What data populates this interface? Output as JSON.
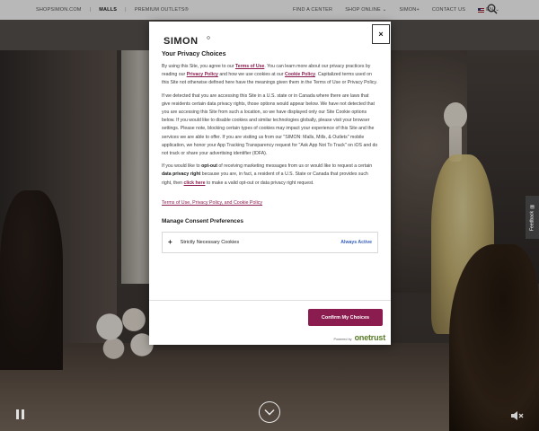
{
  "nav": {
    "left": [
      "SHOPSIMON.COM",
      "MALLS",
      "PREMIUM OUTLETS®"
    ],
    "right": [
      "FIND A CENTER",
      "SHOP ONLINE",
      "SIMON+",
      "CONTACT US"
    ],
    "language": "EN"
  },
  "feedback": {
    "label": "Feedback"
  },
  "modal": {
    "logo_text": "SIMON",
    "close_label": "×",
    "title": "Your Privacy Choices",
    "p1": {
      "t1": "By using this Site, you agree to our ",
      "l1": "Terms of Use",
      "t2": ". You can learn more about our privacy practices by reading our ",
      "l2": "Privacy Policy",
      "t3": " and how we use cookies at our ",
      "l3": "Cookie Policy",
      "t4": ". Capitalized terms used on this Site not otherwise defined here have the meanings given them in the Terms of Use or Privacy Policy."
    },
    "p2": "If we detected that you are accessing this Site in a U.S. state or in Canada where there are laws that give residents certain data privacy rights, those options would appear below. We have not detected that you are accessing this Site from such a location, so we have displayed only our Site Cookie options below. If you would like to disable cookies and similar technologies globally, please visit your browser settings. Please note, blocking certain types of cookies may impact your experience of this Site and the services we are able to offer. If you are visiting us from our \"SIMON: Malls, Mills, & Outlets\" mobile application, we honor your App Tracking Transparency request for \"Ask App Not To Track\" on iOS and do not track or share your advertising identifier (IDFA).",
    "p3": {
      "t1": "If you would like to ",
      "b1": "opt-out",
      "t2": " of receiving marketing messages from us or would like to request a certain ",
      "b2": "data privacy right",
      "t3": " because you are, in fact, a resident of a U.S. State or Canada that provides such right, then ",
      "l1": "click here",
      "t4": " to make a valid opt-out or data privacy right request."
    },
    "terms_link": "Terms of Use, Privacy Policy, and Cookie Policy",
    "consent_title": "Manage Consent Preferences",
    "consent_rows": [
      {
        "label": "Strictly Necessary Cookies",
        "status": "Always Active"
      }
    ],
    "confirm_label": "Confirm My Choices",
    "powered_by": "Powered by",
    "powered_brand": "onetrust"
  },
  "colors": {
    "brand": "#8b1c4f",
    "active": "#3860be"
  }
}
